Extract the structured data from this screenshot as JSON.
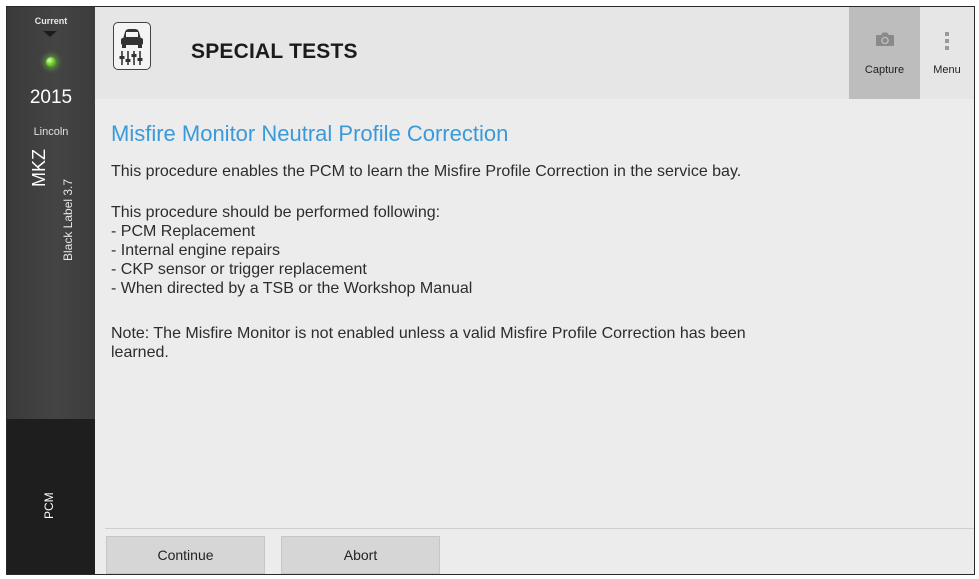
{
  "sidebar": {
    "current_label": "Current",
    "year": "2015",
    "make": "Lincoln",
    "model": "MKZ",
    "trim": "Black Label 3.7",
    "module": "PCM",
    "status_color": "#6fcf2a"
  },
  "header": {
    "title": "SPECIAL TESTS",
    "app_icon": "car-lift-gauges-icon",
    "capture_label": "Capture",
    "capture_icon": "camera-icon",
    "menu_label": "Menu",
    "menu_icon": "vertical-dots-icon"
  },
  "content": {
    "heading": "Misfire Monitor Neutral Profile Correction",
    "intro": "This procedure enables the PCM to learn the Misfire Profile Correction in the service bay.",
    "list_intro": "This procedure should be performed following:",
    "items": [
      " - PCM Replacement",
      " - Internal engine repairs",
      " - CKP sensor or trigger replacement",
      " - When directed by a TSB or the Workshop Manual"
    ],
    "note": "Note: The Misfire Monitor is not enabled unless a valid Misfire Profile Correction has been learned."
  },
  "actions": {
    "continue_label": "Continue",
    "abort_label": "Abort"
  },
  "colors": {
    "heading": "#3a9ad9",
    "sidebar": "#404040",
    "capture_bg": "#bdbdbd"
  }
}
